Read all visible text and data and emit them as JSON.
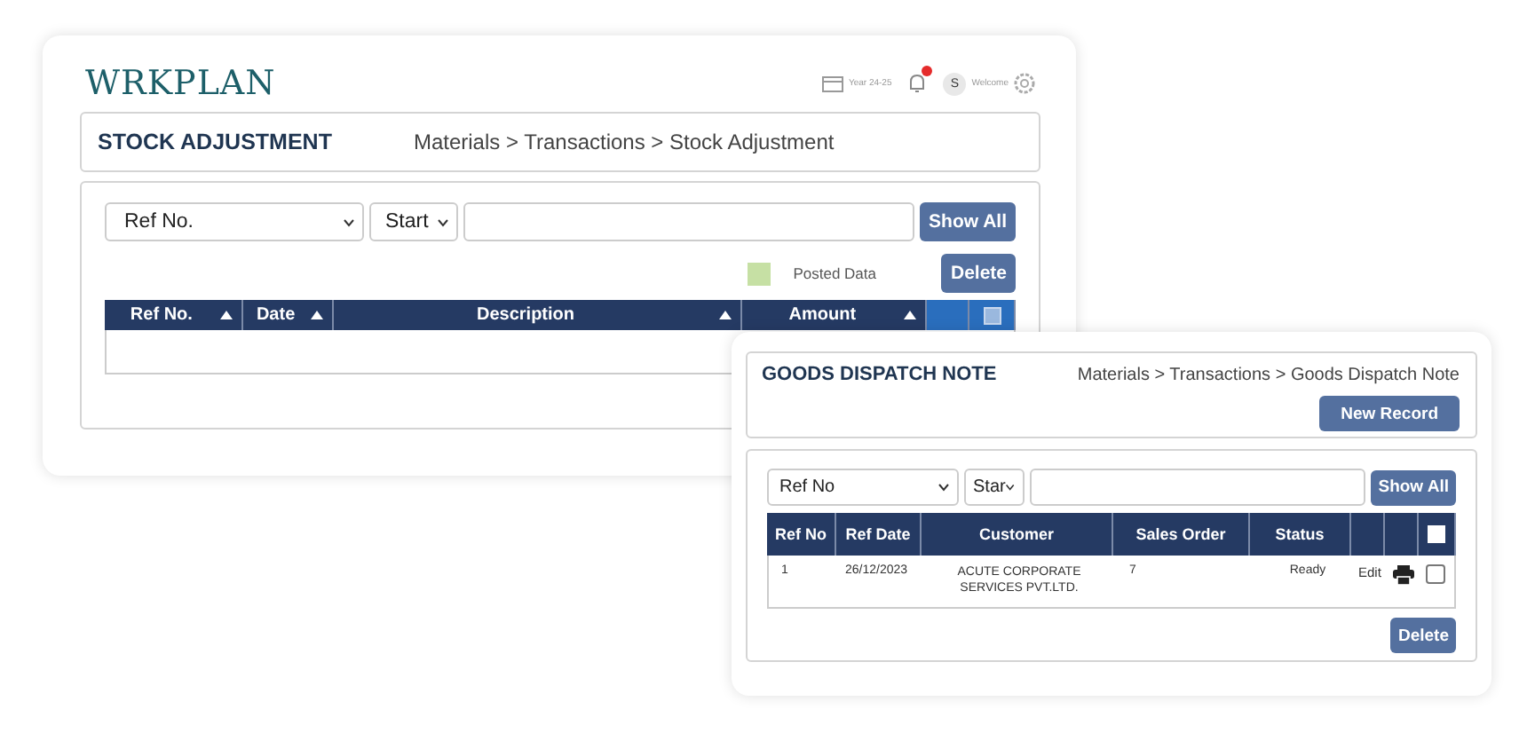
{
  "brand": "WRKPLAN",
  "header": {
    "year": "Year 24-25",
    "notifications": true,
    "avatar": "S",
    "greeting": "Welcome"
  },
  "stock_adjustment": {
    "title": "STOCK ADJUSTMENT",
    "breadcrumb": "Materials > Transactions > Stock Adjustment",
    "filter": {
      "field": "Ref No.",
      "mode": "Start",
      "show_all": "Show All"
    },
    "legend": "Posted Data",
    "delete": "Delete",
    "columns": [
      {
        "label": "Ref No.",
        "sortable": true
      },
      {
        "label": "Date",
        "sortable": true
      },
      {
        "label": "Description",
        "sortable": true
      },
      {
        "label": "Amount",
        "sortable": true
      }
    ],
    "select_all": false
  },
  "goods_dispatch_note": {
    "title": "GOODS DISPATCH NOTE",
    "breadcrumb": "Materials > Transactions > Goods Dispatch Note",
    "new_record": "New Record",
    "filter": {
      "field": "Ref No",
      "mode": "Star",
      "show_all": "Show All"
    },
    "columns": [
      "Ref No",
      "Ref Date",
      "Customer",
      "Sales Order",
      "Status"
    ],
    "select_all": false,
    "rows": [
      {
        "ref_no": "1",
        "date": "26/12/2023",
        "customer": "ACUTE CORPORATE SERVICES PVT.LTD.",
        "sales_order": "7",
        "status": "Ready",
        "edit": "Edit",
        "checked": false
      }
    ],
    "delete": "Delete"
  }
}
